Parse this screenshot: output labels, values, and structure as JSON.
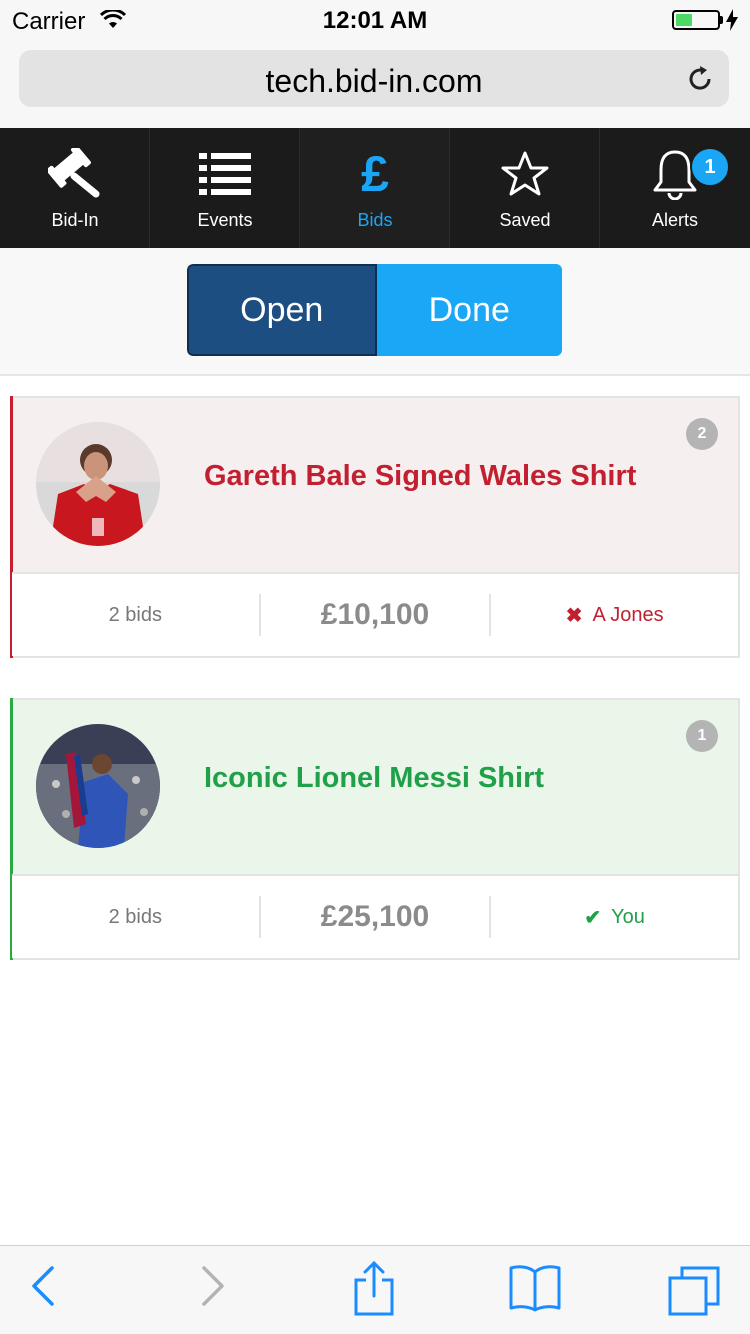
{
  "status_bar": {
    "carrier": "Carrier",
    "time": "12:01 AM",
    "battery_level": 0.4
  },
  "browser": {
    "url": "tech.bid-in.com"
  },
  "nav": {
    "items": [
      {
        "label": "Bid-In",
        "icon": "gavel-icon"
      },
      {
        "label": "Events",
        "icon": "list-icon"
      },
      {
        "label": "Bids",
        "icon": "pound-icon"
      },
      {
        "label": "Saved",
        "icon": "star-icon"
      },
      {
        "label": "Alerts",
        "icon": "bell-icon"
      }
    ],
    "active": "Bids",
    "alerts_badge": "1"
  },
  "segments": {
    "open_label": "Open",
    "done_label": "Done",
    "selected": "Open"
  },
  "bids": [
    {
      "title": "Gareth Bale Signed Wales Shirt",
      "count_badge": "2",
      "bids_text": "2 bids",
      "price": "£10,100",
      "status_text": "A Jones",
      "status_icon": "cross-icon",
      "status_color": "#c21f30"
    },
    {
      "title": "Iconic Lionel Messi Shirt",
      "count_badge": "1",
      "bids_text": "2 bids",
      "price": "£25,100",
      "status_text": "You",
      "status_icon": "check-icon",
      "status_color": "#21a04a"
    }
  ],
  "colors": {
    "nav_bg": "#1b1b1b",
    "accent": "#1ba6f5",
    "open_btn": "#1d4e81",
    "done_btn": "#1aa8f6"
  }
}
